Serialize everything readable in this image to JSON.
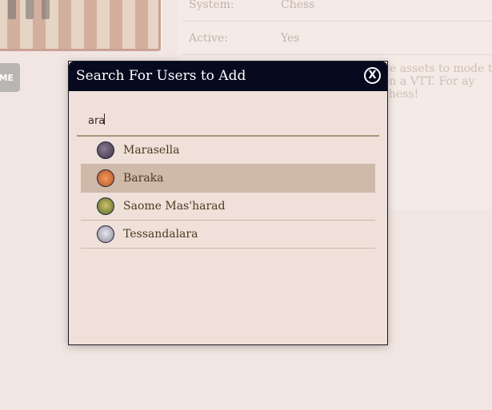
{
  "background": {
    "info": [
      {
        "label": "System:",
        "value": "Chess"
      },
      {
        "label": "Active:",
        "value": "Yes"
      }
    ],
    "description": "ge assets to mode t on a VTT. For ay chess!",
    "button_label": "ME"
  },
  "modal": {
    "title": "Search For Users to Add",
    "close_label": "X",
    "search": {
      "value": "ara",
      "placeholder": ""
    },
    "results": [
      {
        "name": "Marasella",
        "avatar": "marasella-avatar",
        "selected": false
      },
      {
        "name": "Baraka",
        "avatar": "baraka-avatar",
        "selected": true
      },
      {
        "name": "Saome Mas'harad",
        "avatar": "saome-avatar",
        "selected": false
      },
      {
        "name": "Tessandalara",
        "avatar": "tessandalara-avatar",
        "selected": false
      }
    ]
  },
  "colors": {
    "header_bg": "#070a1e",
    "modal_bg": "#efe0d9",
    "selected_row": "#cfb9a9",
    "page_bg": "#f1e6e2"
  }
}
